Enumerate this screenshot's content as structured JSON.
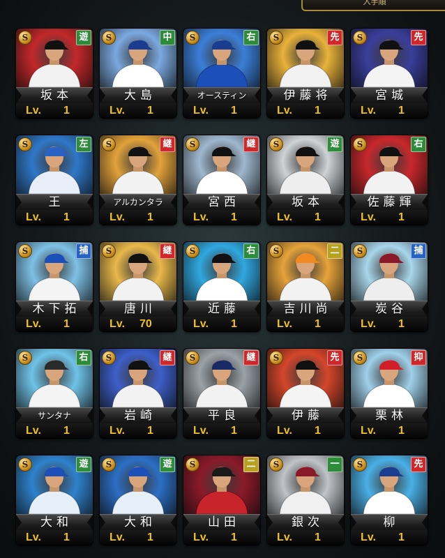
{
  "header": {
    "label": "入手順"
  },
  "level_prefix": "Lv.",
  "colors": {
    "pos_red": "#d0282a",
    "pos_green": "#2e8b3a",
    "pos_yellow": "#b8a020",
    "pos_blue": "#2a62c4"
  },
  "cards": [
    {
      "rarity": "S",
      "position": "遊",
      "position_color": "green",
      "name": "坂本",
      "level": "1",
      "bg": "#c2282a",
      "uniform": "#f2f2f2",
      "cap": "#111111"
    },
    {
      "rarity": "S",
      "position": "中",
      "position_color": "green",
      "name": "大島",
      "level": "1",
      "bg": "#7aa9e0",
      "uniform": "#ffffff",
      "cap": "#1a3d8f"
    },
    {
      "rarity": "S",
      "position": "右",
      "position_color": "green",
      "name": "オースティン",
      "level": "1",
      "bg": "#3b7fd8",
      "uniform": "#1d4fb8",
      "cap": "#1a3d8f"
    },
    {
      "rarity": "S",
      "position": "先",
      "position_color": "red",
      "name": "伊藤将",
      "level": "1",
      "bg": "#e8b23a",
      "uniform": "#f2f2f2",
      "cap": "#111111"
    },
    {
      "rarity": "S",
      "position": "先",
      "position_color": "red",
      "name": "宮城",
      "level": "1",
      "bg": "#3a3e9a",
      "uniform": "#f4f4f4",
      "cap": "#111111"
    },
    {
      "rarity": "S",
      "position": "左",
      "position_color": "green",
      "name": "王",
      "level": "1",
      "bg": "#2f78c8",
      "uniform": "#e8eef7",
      "cap": "#2a62c4"
    },
    {
      "rarity": "S",
      "position": "継",
      "position_color": "red",
      "name": "アルカンタラ",
      "level": "1",
      "bg": "#e2a23a",
      "uniform": "#f2f2f2",
      "cap": "#111111"
    },
    {
      "rarity": "S",
      "position": "継",
      "position_color": "red",
      "name": "宮西",
      "level": "1",
      "bg": "#9fb8cf",
      "uniform": "#ffffff",
      "cap": "#111111"
    },
    {
      "rarity": "S",
      "position": "遊",
      "position_color": "green",
      "name": "坂本",
      "level": "1",
      "bg": "#cfd3d6",
      "uniform": "#eeeeee",
      "cap": "#111111"
    },
    {
      "rarity": "S",
      "position": "右",
      "position_color": "green",
      "name": "佐藤輝",
      "level": "1",
      "bg": "#c8282c",
      "uniform": "#f2f2f2",
      "cap": "#111111"
    },
    {
      "rarity": "S",
      "position": "捕",
      "position_color": "blue",
      "name": "木下拓",
      "level": "1",
      "bg": "#7ec1e6",
      "uniform": "#f4f4f4",
      "cap": "#1d4fb8"
    },
    {
      "rarity": "S",
      "position": "継",
      "position_color": "red",
      "name": "唐川",
      "level": "70",
      "bg": "#e8b84a",
      "uniform": "#f2f2f2",
      "cap": "#111111"
    },
    {
      "rarity": "S",
      "position": "右",
      "position_color": "green",
      "name": "近藤",
      "level": "1",
      "bg": "#2fa8e0",
      "uniform": "#ffffff",
      "cap": "#111111"
    },
    {
      "rarity": "S",
      "position": "二",
      "position_color": "yellow",
      "name": "吉川尚",
      "level": "1",
      "bg": "#e6a33a",
      "uniform": "#f2f2f2",
      "cap": "#f08a20"
    },
    {
      "rarity": "S",
      "position": "捕",
      "position_color": "blue",
      "name": "炭谷",
      "level": "1",
      "bg": "#a8d6ea",
      "uniform": "#eeeeee",
      "cap": "#8a1828"
    },
    {
      "rarity": "S",
      "position": "右",
      "position_color": "green",
      "name": "サンタナ",
      "level": "1",
      "bg": "#6fc3e8",
      "uniform": "#f4f4f4",
      "cap": "#2a2a2a"
    },
    {
      "rarity": "S",
      "position": "継",
      "position_color": "red",
      "name": "岩崎",
      "level": "1",
      "bg": "#3d5fc8",
      "uniform": "#f2f2f2",
      "cap": "#111111"
    },
    {
      "rarity": "S",
      "position": "継",
      "position_color": "red",
      "name": "平良",
      "level": "1",
      "bg": "#9aa2a8",
      "uniform": "#f2f2f2",
      "cap": "#1a2a66"
    },
    {
      "rarity": "S",
      "position": "先",
      "position_color": "red",
      "name": "伊藤",
      "level": "1",
      "bg": "#d4462a",
      "uniform": "#f4f4f4",
      "cap": "#111111"
    },
    {
      "rarity": "S",
      "position": "抑",
      "position_color": "red",
      "name": "栗林",
      "level": "1",
      "bg": "#9fd0ea",
      "uniform": "#ffffff",
      "cap": "#d01e2a"
    },
    {
      "rarity": "S",
      "position": "遊",
      "position_color": "green",
      "name": "大和",
      "level": "1",
      "bg": "#2e82cc",
      "uniform": "#e6eef8",
      "cap": "#1d4fb8"
    },
    {
      "rarity": "S",
      "position": "遊",
      "position_color": "green",
      "name": "大和",
      "level": "1",
      "bg": "#2c6fc4",
      "uniform": "#e6eef8",
      "cap": "#1d4fb8"
    },
    {
      "rarity": "S",
      "position": "二",
      "position_color": "yellow",
      "name": "山田",
      "level": "1",
      "bg": "#8a1a2a",
      "uniform": "#c8242c",
      "cap": "#1a1a1a"
    },
    {
      "rarity": "S",
      "position": "一",
      "position_color": "green",
      "name": "銀次",
      "level": "1",
      "bg": "#c0c4c8",
      "uniform": "#f0f0f0",
      "cap": "#8a1828"
    },
    {
      "rarity": "S",
      "position": "先",
      "position_color": "red",
      "name": "柳",
      "level": "1",
      "bg": "#4ab0e6",
      "uniform": "#ffffff",
      "cap": "#1a3d8f"
    }
  ]
}
